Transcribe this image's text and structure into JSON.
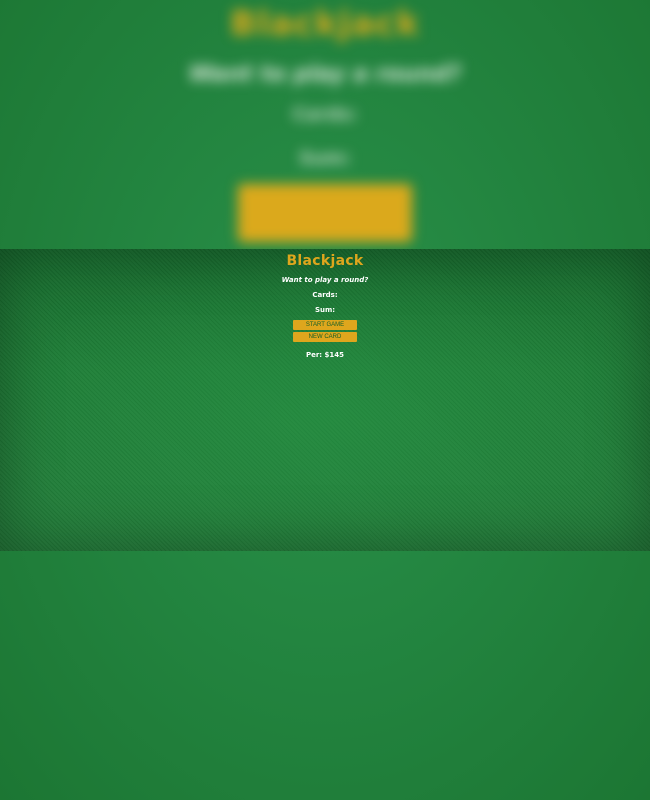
{
  "game": {
    "title": "Blackjack",
    "message": "Want to play a round?",
    "cards_label": "Cards:",
    "sum_label": "Sum:",
    "start_button_label": "START GAME",
    "new_card_button_label": "NEW CARD",
    "player_info": "Per: $145"
  },
  "colors": {
    "felt_green": "#1e7d37",
    "accent_gold": "#dea61d",
    "text_white": "#ffffff"
  }
}
